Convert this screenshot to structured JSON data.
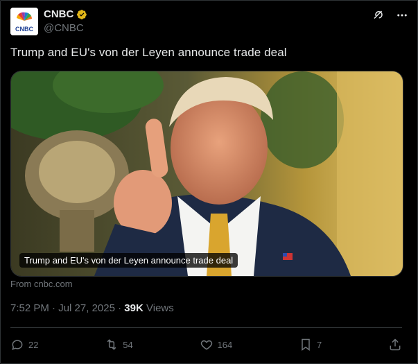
{
  "account": {
    "display_name": "CNBC",
    "handle": "@CNBC",
    "avatar_text": "CNBC",
    "verified_color": "#e2b719"
  },
  "tweet": {
    "text": "Trump and EU's von der Leyen announce trade deal"
  },
  "card": {
    "caption": "Trump and EU's von der Leyen announce trade deal",
    "source": "From cnbc.com"
  },
  "meta": {
    "time": "7:52 PM",
    "separator": "·",
    "date": "Jul 27, 2025",
    "views_count": "39K",
    "views_label": "Views"
  },
  "actions": {
    "replies": "22",
    "reposts": "54",
    "likes": "164",
    "bookmarks": "7"
  },
  "colors": {
    "background": "#000000",
    "text_primary": "#e7e9ea",
    "text_secondary": "#71767b",
    "border": "#2f3336"
  }
}
